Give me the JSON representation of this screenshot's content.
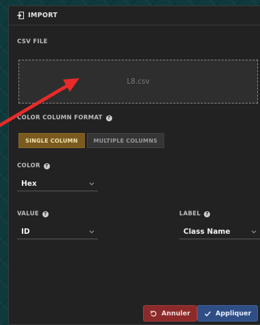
{
  "dialog": {
    "title": "IMPORT",
    "icon": "import-icon"
  },
  "csv": {
    "label": "CSV FILE",
    "filename": "L8.csv"
  },
  "format": {
    "label": "COLOR COLUMN FORMAT",
    "options": [
      "SINGLE COLUMN",
      "MULTIPLE COLUMNS"
    ],
    "selected": "SINGLE COLUMN"
  },
  "color": {
    "label": "COLOR",
    "value": "Hex"
  },
  "value_field": {
    "label": "VALUE",
    "value": "ID"
  },
  "label_field": {
    "label": "LABEL",
    "value": "Class Name"
  },
  "footer": {
    "cancel_label": "Annuler",
    "apply_label": "Appliquer"
  },
  "colors": {
    "accent_active": "#7a5a1f",
    "cancel": "#8c2a2a",
    "apply": "#2f4e86",
    "annotation_arrow": "#e82a2a"
  }
}
